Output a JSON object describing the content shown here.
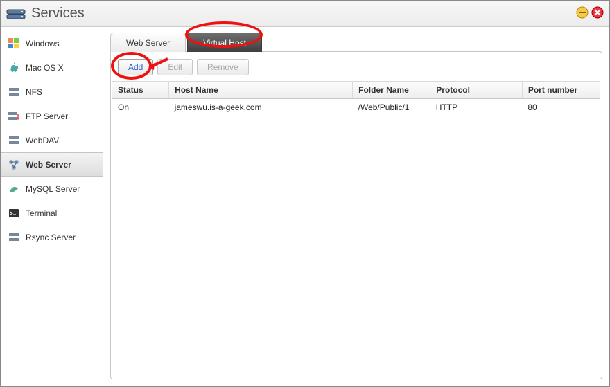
{
  "titlebar": {
    "title": "Services"
  },
  "sidebar": {
    "items": [
      {
        "label": "Windows"
      },
      {
        "label": "Mac OS X"
      },
      {
        "label": "NFS"
      },
      {
        "label": "FTP Server"
      },
      {
        "label": "WebDAV"
      },
      {
        "label": "Web Server"
      },
      {
        "label": "MySQL Server"
      },
      {
        "label": "Terminal"
      },
      {
        "label": "Rsync Server"
      }
    ],
    "selected_index": 5
  },
  "tabs": {
    "web_server_label": "Web Server",
    "virtual_host_label": "Virtual Host",
    "active_index": 1
  },
  "toolbar": {
    "add_label": "Add",
    "edit_label": "Edit",
    "remove_label": "Remove"
  },
  "table": {
    "headers": {
      "status": "Status",
      "host_name": "Host Name",
      "folder_name": "Folder Name",
      "protocol": "Protocol",
      "port_number": "Port number"
    },
    "rows": [
      {
        "status": "On",
        "host_name": "jameswu.is-a-geek.com",
        "folder_name": "/Web/Public/1",
        "protocol": "HTTP",
        "port_number": "80"
      }
    ]
  },
  "annotations": {
    "virtual_host_tab_circled": true,
    "add_button_circled": true,
    "arrow_to_add": true
  }
}
